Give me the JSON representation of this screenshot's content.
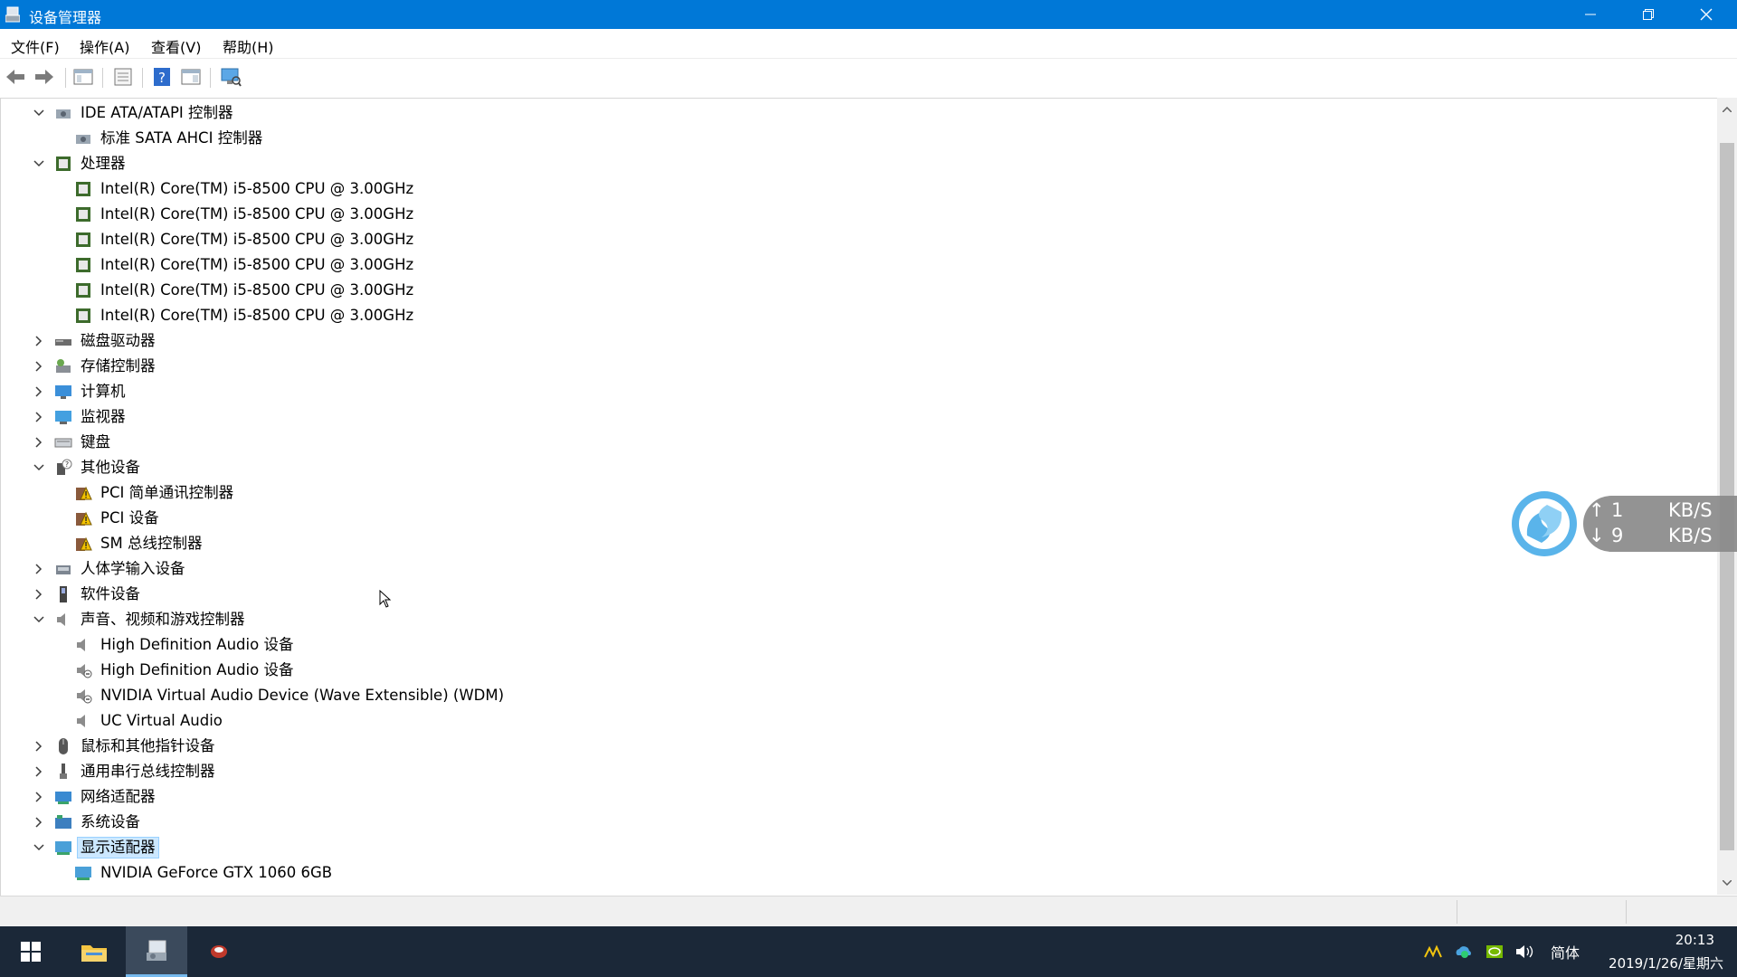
{
  "window": {
    "title": "设备管理器"
  },
  "menu": [
    "文件(F)",
    "操作(A)",
    "查看(V)",
    "帮助(H)"
  ],
  "toolbar": {
    "buttons": [
      "back-arrow-icon",
      "forward-arrow-icon",
      "show-hide-tree-icon",
      "properties-icon",
      "help-icon",
      "action-pane-icon",
      "scan-hardware-icon"
    ]
  },
  "tree": [
    {
      "label": "IDE ATA/ATAPI 控制器",
      "level": 0,
      "state": "expanded",
      "icon": "ide-controller-icon"
    },
    {
      "label": "标准 SATA AHCI 控制器",
      "level": 1,
      "icon": "ide-controller-icon"
    },
    {
      "label": "处理器",
      "level": 0,
      "state": "expanded",
      "icon": "processor-icon"
    },
    {
      "label": "Intel(R) Core(TM) i5-8500 CPU @ 3.00GHz",
      "level": 1,
      "icon": "processor-icon"
    },
    {
      "label": "Intel(R) Core(TM) i5-8500 CPU @ 3.00GHz",
      "level": 1,
      "icon": "processor-icon"
    },
    {
      "label": "Intel(R) Core(TM) i5-8500 CPU @ 3.00GHz",
      "level": 1,
      "icon": "processor-icon"
    },
    {
      "label": "Intel(R) Core(TM) i5-8500 CPU @ 3.00GHz",
      "level": 1,
      "icon": "processor-icon"
    },
    {
      "label": "Intel(R) Core(TM) i5-8500 CPU @ 3.00GHz",
      "level": 1,
      "icon": "processor-icon"
    },
    {
      "label": "Intel(R) Core(TM) i5-8500 CPU @ 3.00GHz",
      "level": 1,
      "icon": "processor-icon"
    },
    {
      "label": "磁盘驱动器",
      "level": 0,
      "state": "collapsed",
      "icon": "disk-drive-icon"
    },
    {
      "label": "存储控制器",
      "level": 0,
      "state": "collapsed",
      "icon": "storage-controller-icon"
    },
    {
      "label": "计算机",
      "level": 0,
      "state": "collapsed",
      "icon": "computer-icon"
    },
    {
      "label": "监视器",
      "level": 0,
      "state": "collapsed",
      "icon": "monitor-icon"
    },
    {
      "label": "键盘",
      "level": 0,
      "state": "collapsed",
      "icon": "keyboard-icon"
    },
    {
      "label": "其他设备",
      "level": 0,
      "state": "expanded",
      "icon": "other-devices-icon"
    },
    {
      "label": "PCI 简单通讯控制器",
      "level": 1,
      "icon": "warning-device-icon"
    },
    {
      "label": "PCI 设备",
      "level": 1,
      "icon": "warning-device-icon"
    },
    {
      "label": "SM 总线控制器",
      "level": 1,
      "icon": "warning-device-icon"
    },
    {
      "label": "人体学输入设备",
      "level": 0,
      "state": "collapsed",
      "icon": "hid-icon"
    },
    {
      "label": "软件设备",
      "level": 0,
      "state": "collapsed",
      "icon": "software-device-icon"
    },
    {
      "label": "声音、视频和游戏控制器",
      "level": 0,
      "state": "expanded",
      "icon": "speaker-icon"
    },
    {
      "label": "High Definition Audio 设备",
      "level": 1,
      "icon": "speaker-icon"
    },
    {
      "label": "High Definition Audio 设备",
      "level": 1,
      "icon": "speaker-disabled-icon"
    },
    {
      "label": "NVIDIA Virtual Audio Device (Wave Extensible) (WDM)",
      "level": 1,
      "icon": "speaker-disabled-icon"
    },
    {
      "label": "UC Virtual Audio",
      "level": 1,
      "icon": "speaker-icon"
    },
    {
      "label": "鼠标和其他指针设备",
      "level": 0,
      "state": "collapsed",
      "icon": "mouse-icon"
    },
    {
      "label": "通用串行总线控制器",
      "level": 0,
      "state": "collapsed",
      "icon": "usb-icon"
    },
    {
      "label": "网络适配器",
      "level": 0,
      "state": "collapsed",
      "icon": "network-adapter-icon"
    },
    {
      "label": "系统设备",
      "level": 0,
      "state": "collapsed",
      "icon": "system-device-icon"
    },
    {
      "label": "显示适配器",
      "level": 0,
      "state": "expanded",
      "icon": "display-adapter-icon",
      "selected": true
    },
    {
      "label": "NVIDIA GeForce GTX 1060 6GB",
      "level": 1,
      "icon": "display-adapter-icon"
    }
  ],
  "net_widget": {
    "up_value": "1",
    "down_value": "9",
    "unit": "KB/S",
    "up_arrow": "↑",
    "down_arrow": "↓"
  },
  "taskbar": {
    "ime": "简体",
    "time": "20:13",
    "date": "2019/1/26/星期六"
  },
  "colors": {
    "titlebar": "#0078d7",
    "taskbar": "#1b2838",
    "selection": "#cce8ff"
  }
}
